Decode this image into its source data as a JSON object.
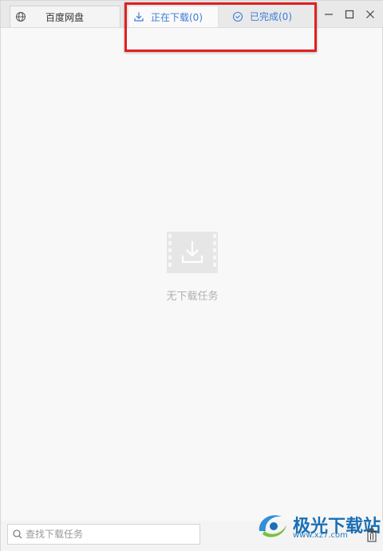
{
  "tabs": {
    "baidu": {
      "label": "百度网盘",
      "icon": "globe-icon"
    },
    "downloading": {
      "label": "正在下载(0)",
      "icon": "download-icon"
    },
    "done": {
      "label": "已完成(0)",
      "icon": "check-circle-icon"
    }
  },
  "window_controls": [
    "minimize-icon",
    "maximize-icon",
    "close-icon"
  ],
  "empty_state": {
    "text": "无下载任务",
    "icon": "video-download-icon"
  },
  "search": {
    "placeholder": "查找下载任务",
    "value": ""
  },
  "watermark": {
    "text": "极光下载站",
    "sub": "www.xz7.com"
  },
  "colors": {
    "accent": "#3d7bd9",
    "highlight": "#e02020",
    "empty_icon": "#e6e6e6"
  }
}
